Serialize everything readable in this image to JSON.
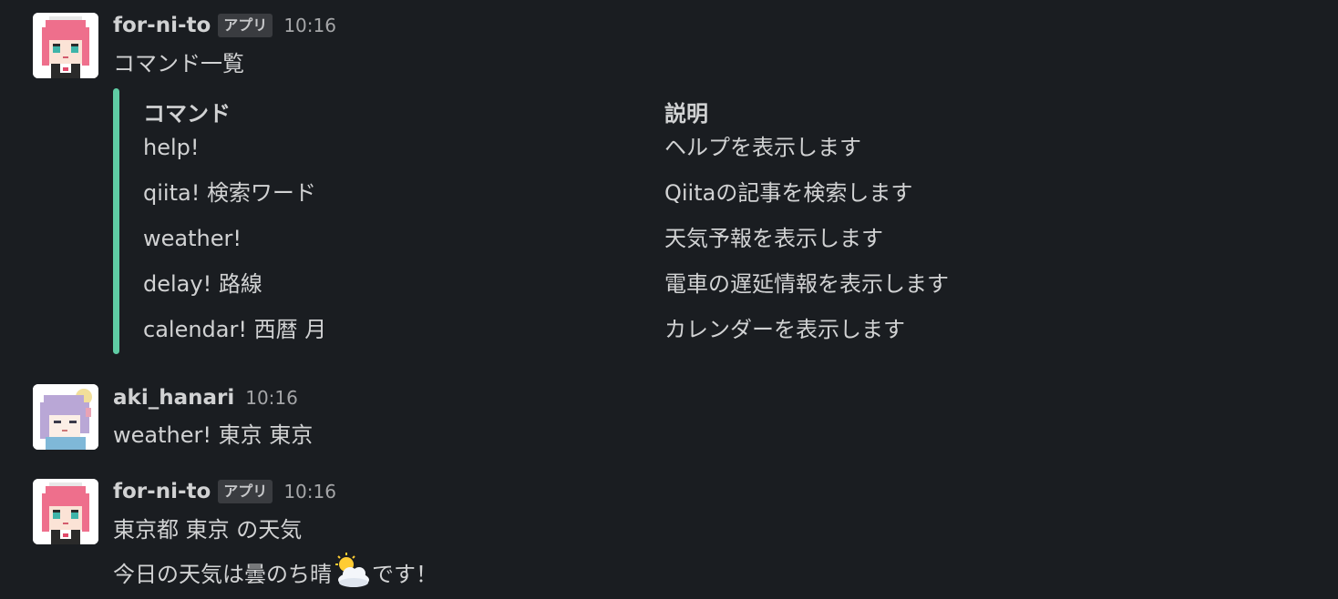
{
  "messages": [
    {
      "username": "for-ni-to",
      "badge": "アプリ",
      "time": "10:16",
      "text": "コマンド一覧",
      "attachment": {
        "accent_color": "#5fcca4",
        "columns": [
          "コマンド",
          "説明"
        ],
        "rows": [
          {
            "command": "help!",
            "description": "ヘルプを表示します"
          },
          {
            "command": "qiita! 検索ワード",
            "description": "Qiitaの記事を検索します"
          },
          {
            "command": "weather!",
            "description": "天気予報を表示します"
          },
          {
            "command": "delay! 路線",
            "description": "電車の遅延情報を表示します"
          },
          {
            "command": "calendar! 西暦 月",
            "description": "カレンダーを表示します"
          }
        ]
      }
    },
    {
      "username": "aki_hanari",
      "time": "10:16",
      "text": "weather! 東京 東京"
    },
    {
      "username": "for-ni-to",
      "badge": "アプリ",
      "time": "10:16",
      "lines": [
        "東京都 東京 の天気",
        "今日の天気は曇のち晴",
        "です！"
      ],
      "emoji": "sun-behind-cloud-icon"
    }
  ],
  "colors": {
    "background": "#1a1d21",
    "text": "#d1d2d3",
    "muted": "#a5a6a8",
    "badge_bg": "#3a3c40"
  }
}
